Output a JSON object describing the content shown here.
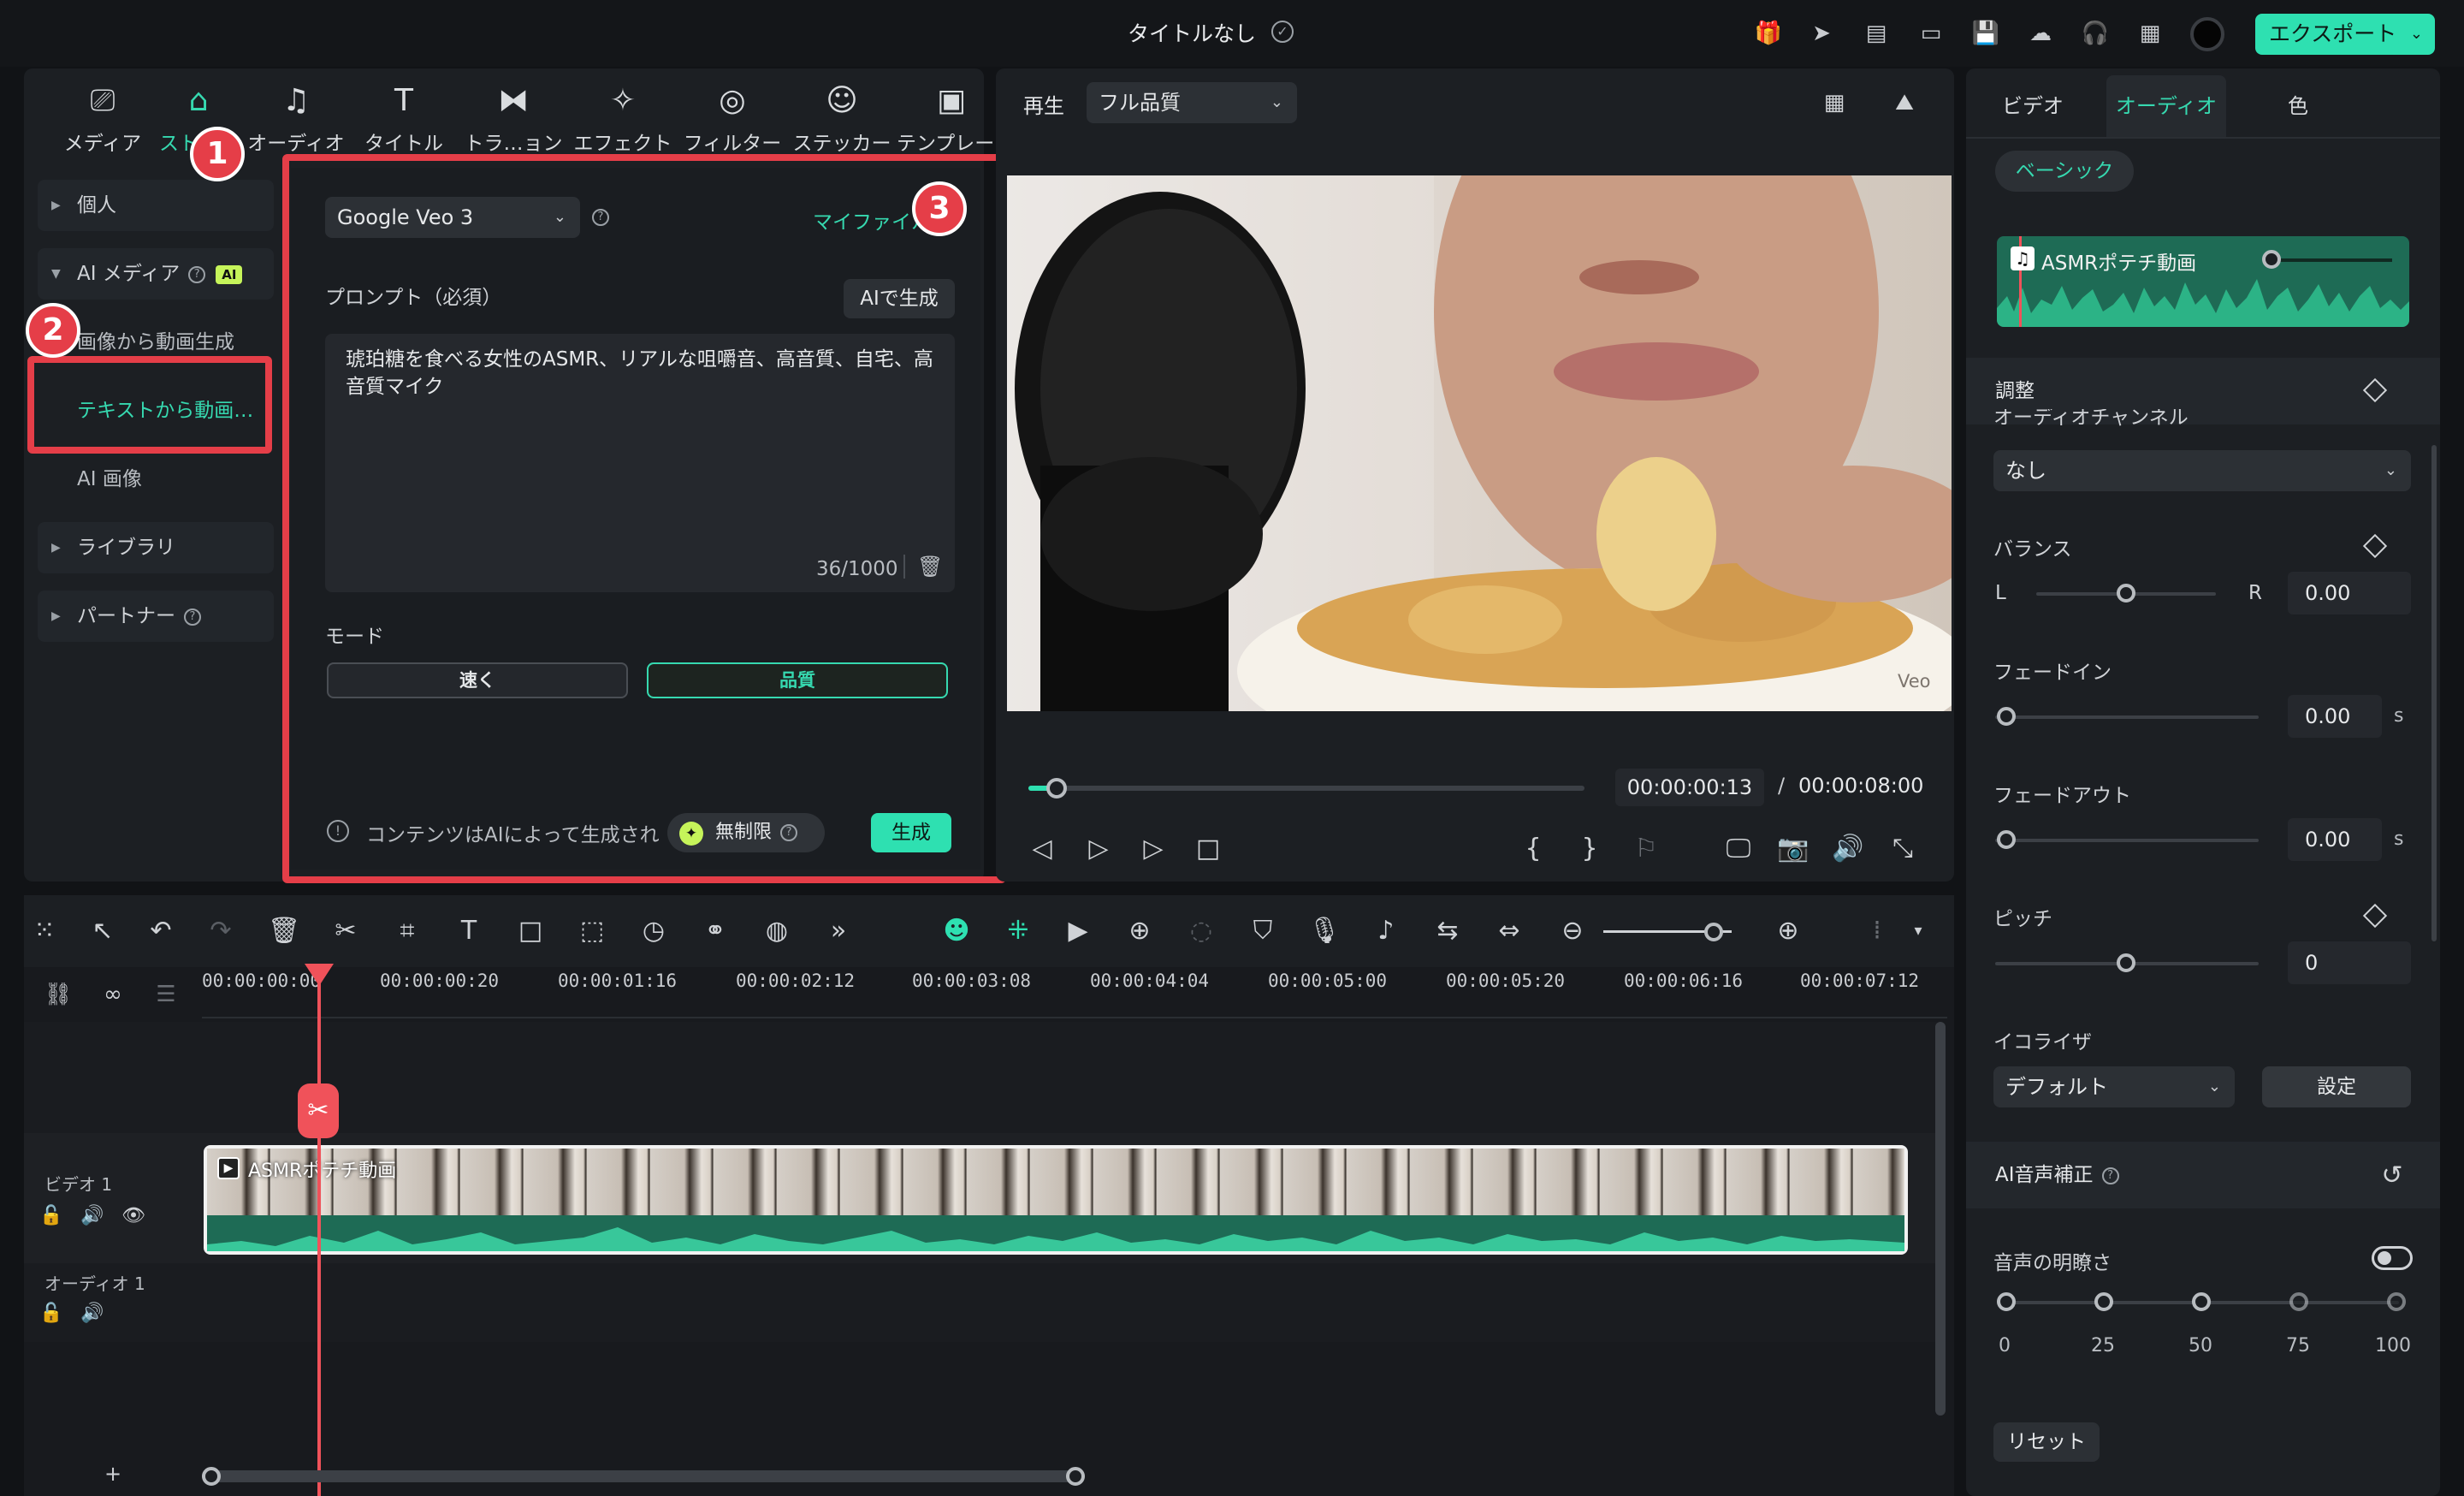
{
  "app": {
    "title": "タイトルなし",
    "export_label": "エクスポート"
  },
  "colors": {
    "accent": "#2ee0b1",
    "highlight_red": "#e53e48",
    "ai_badge": "#c6f45a"
  },
  "media_tabs": [
    {
      "label": "メディア",
      "icon": "media-icon"
    },
    {
      "label": "ストック",
      "icon": "stock-icon"
    },
    {
      "label": "オーディオ",
      "icon": "music-note-icon"
    },
    {
      "label": "タイトル",
      "icon": "text-icon"
    },
    {
      "label": "トラ…ョン",
      "icon": "transition-icon"
    },
    {
      "label": "エフェクト",
      "icon": "effects-icon"
    },
    {
      "label": "フィルター",
      "icon": "filter-icon"
    },
    {
      "label": "ステッカー",
      "icon": "sticker-icon"
    },
    {
      "label": "テンプレート",
      "icon": "template-icon"
    }
  ],
  "sidebar": {
    "personal": "個人",
    "ai_media": "AI メディア",
    "ai_badge": "AI",
    "image_to_video": "画像から動画生成",
    "text_to_video": "テキストから動画…",
    "ai_image": "AI 画像",
    "library": "ライブラリ",
    "partner": "パートナー"
  },
  "badges": {
    "one": "1",
    "two": "2",
    "three": "3"
  },
  "ai_panel": {
    "model": "Google Veo 3",
    "my_files": "マイファイル",
    "prompt_label": "プロンプト（必須）",
    "ai_generate": "AIで生成",
    "prompt_text": "琥珀糖を食べる女性のASMR、リアルな咀嚼音、高音質、自宅、高音質マイク",
    "char_count": "36/1000",
    "mode_label": "モード",
    "mode_fast": "速く",
    "mode_quality": "品質",
    "notice": "コンテンツはAIによって生成され",
    "unlimited": "無制限",
    "generate": "生成"
  },
  "preview": {
    "play_label": "再生",
    "quality": "フル品質",
    "watermark": "Veo",
    "current_time": "00:00:00:13",
    "separator": "/",
    "total_time": "00:00:08:00",
    "progress": 0.05
  },
  "right_panel": {
    "tabs": [
      "ビデオ",
      "オーディオ",
      "色"
    ],
    "basic": "ベーシック",
    "clip_name": "ASMRポテチ動画",
    "adjust": "調整",
    "partial_label": "オーディオチャンネル",
    "none": "なし",
    "balance": "バランス",
    "left": "L",
    "right": "R",
    "balance_value": "0.00",
    "fade_in": "フェードイン",
    "fade_in_value": "0.00",
    "fade_out": "フェードアウト",
    "fade_out_value": "0.00",
    "unit_s": "s",
    "pitch": "ピッチ",
    "pitch_value": "0",
    "equalizer": "イコライザ",
    "eq_default": "デフォルト",
    "settings": "設定",
    "ai_voice": "AI音声補正",
    "clarity": "音声の明瞭さ",
    "ticks": [
      "0",
      "25",
      "50",
      "75",
      "100"
    ],
    "reset": "リセット"
  },
  "timeline": {
    "ruler": [
      "00:00:00:00",
      "00:00:00:20",
      "00:00:01:16",
      "00:00:02:12",
      "00:00:03:08",
      "00:00:04:04",
      "00:00:05:00",
      "00:00:05:20",
      "00:00:06:16",
      "00:00:07:12"
    ],
    "video_track": "ビデオ 1",
    "audio_track": "オーディオ 1",
    "clip_label": "ASMRポテチ動画",
    "add": "+"
  }
}
